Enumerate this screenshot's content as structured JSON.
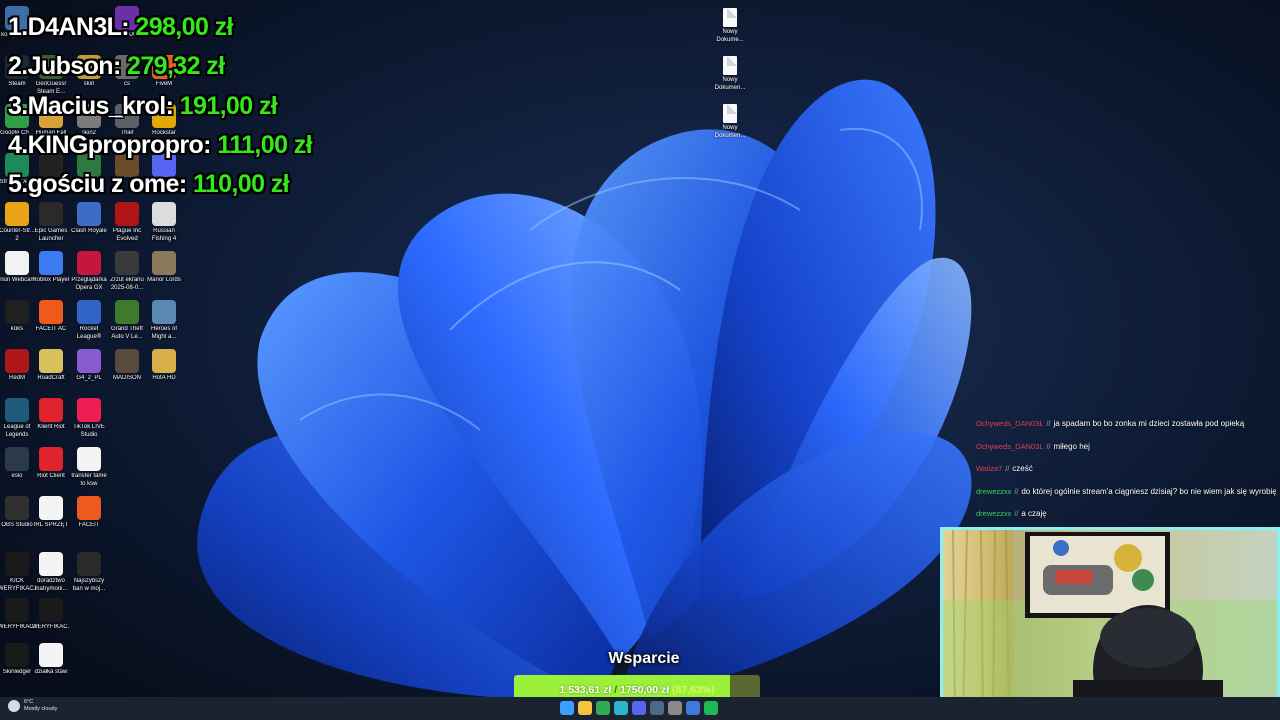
{
  "desktop": {
    "left_icons": [
      {
        "label": "komputer ...",
        "icon": "computer-icon",
        "color": "#3d6ea8"
      },
      {
        "label": "GALAXY",
        "icon": "galaxy-icon",
        "color": "#6b2fa8"
      },
      {
        "label": "Steam",
        "icon": "steam-icon",
        "color": "#1b2838"
      },
      {
        "label": "GeoGuessr Steam E...",
        "icon": "geoguessr-icon",
        "color": "#3a5f2f"
      },
      {
        "label": "skin",
        "icon": "folder-icon",
        "color": "#c79a37"
      },
      {
        "label": "cs",
        "icon": "folder-icon",
        "color": "#6a6a6a"
      },
      {
        "label": "FiveM",
        "icon": "fivem-icon",
        "color": "#e5601f"
      },
      {
        "label": "Google Ch...",
        "icon": "chrome-icon",
        "color": "#2f9e44"
      },
      {
        "label": "Human Fall Flat",
        "icon": "human-fall-flat-icon",
        "color": "#d8a23a"
      },
      {
        "label": "skin2",
        "icon": "folder-icon",
        "color": "#7a7a7a"
      },
      {
        "label": "Thief",
        "icon": "thief-icon",
        "color": "#5b5f66"
      },
      {
        "label": "Rockstar",
        "icon": "rockstar-icon",
        "color": "#e0a800"
      },
      {
        "label": "Strea... Deck",
        "icon": "stream-deck-icon",
        "color": "#1e8a5a"
      },
      {
        "label": "",
        "icon": "app-icon",
        "color": "#222"
      },
      {
        "label": "",
        "icon": "app-icon",
        "color": "#2c7a3f"
      },
      {
        "label": "",
        "icon": "app-icon",
        "color": "#6b4b2a"
      },
      {
        "label": "",
        "icon": "discord-icon",
        "color": "#5865f2"
      },
      {
        "label": "Counter-Str... 2",
        "icon": "cs2-icon",
        "color": "#e8a317"
      },
      {
        "label": "Epic Games Launcher",
        "icon": "epic-games-icon",
        "color": "#2a2a2a"
      },
      {
        "label": "Clash Royale",
        "icon": "clash-royale-icon",
        "color": "#3b6cc6"
      },
      {
        "label": "Plague Inc Evolved",
        "icon": "plague-inc-icon",
        "color": "#b01414"
      },
      {
        "label": "Russian Fishing 4",
        "icon": "russian-fishing-icon",
        "color": "#dcdcdc"
      },
      {
        "label": "Iriun Webcam",
        "icon": "iriun-webcam-icon",
        "color": "#f2f2f2"
      },
      {
        "label": "Roblox Player",
        "icon": "roblox-icon",
        "color": "#3d7bf2"
      },
      {
        "label": "Przeglądarka Opera GX",
        "icon": "opera-gx-icon",
        "color": "#c3173b"
      },
      {
        "label": "Zrzut ekranu 2025-08-0...",
        "icon": "screenshot-icon",
        "color": "#3a3a3a"
      },
      {
        "label": "Manor Lords",
        "icon": "manor-lords-icon",
        "color": "#8a7a5a"
      },
      {
        "label": "koks",
        "icon": "file-icon",
        "color": "#202020"
      },
      {
        "label": "FACEIT AC",
        "icon": "faceit-ac-icon",
        "color": "#ef5a1c"
      },
      {
        "label": "Rocket League®",
        "icon": "rocket-league-icon",
        "color": "#2f66c6"
      },
      {
        "label": "Grand Theft Auto V Le...",
        "icon": "gta-v-icon",
        "color": "#3e7a2d"
      },
      {
        "label": "Heroes of Might a...",
        "icon": "heroes-icon",
        "color": "#5a8ab3"
      },
      {
        "label": "RedM",
        "icon": "redm-icon",
        "color": "#b0151a"
      },
      {
        "label": "RoadCraft",
        "icon": "roadcraft-icon",
        "color": "#d8c05a"
      },
      {
        "label": "G4_2_PL",
        "icon": "folder-icon",
        "color": "#8a5ad0"
      },
      {
        "label": "MADISON",
        "icon": "madison-icon",
        "color": "#5a4a3a"
      },
      {
        "label": "HotA HD",
        "icon": "hota-icon",
        "color": "#d8b04a"
      },
      {
        "label": "League of Legends",
        "icon": "league-icon",
        "color": "#1e5a7a"
      },
      {
        "label": "Klient Riot",
        "icon": "riot-client-icon",
        "color": "#e0242f"
      },
      {
        "label": "TikTok LIVE Studio",
        "icon": "tiktok-icon",
        "color": "#ee1d52"
      },
      {
        "label": "eslo",
        "icon": "file-icon",
        "color": "#2a3a4a"
      },
      {
        "label": "Riot Client",
        "icon": "riot-client-icon",
        "color": "#e0242f"
      },
      {
        "label": "transfer fame to ksw",
        "icon": "document-icon",
        "color": "#f4f4f4"
      },
      {
        "label": "OBS Studio",
        "icon": "obs-icon",
        "color": "#303030"
      },
      {
        "label": "IRL SPRZĘT",
        "icon": "document-icon",
        "color": "#f4f4f4"
      },
      {
        "label": "FACEIT",
        "icon": "faceit-icon",
        "color": "#ef5a1c"
      },
      {
        "label": "KICK WERYFIKACJA",
        "icon": "file-icon",
        "color": "#1a1a1a"
      },
      {
        "label": "doradztwo matrymoni...",
        "icon": "document-icon",
        "color": "#f4f4f4"
      },
      {
        "label": "Najszybszy ban w moj...",
        "icon": "file-icon",
        "color": "#2a2a2a"
      },
      {
        "label": "WERYFIKACJA",
        "icon": "file-icon",
        "color": "#1a1a1a"
      },
      {
        "label": "WERYFIKAC...",
        "icon": "file-icon",
        "color": "#1a1a1a"
      },
      {
        "label": "Skinledger",
        "icon": "skinledger-icon",
        "color": "#1a1a1a"
      },
      {
        "label": "działka staw",
        "icon": "document-icon",
        "color": "#f4f4f4"
      }
    ],
    "right_icons": [
      {
        "label": "Nowy Dokume...",
        "icon": "document-icon"
      },
      {
        "label": "Nowy Dokumen...",
        "icon": "document-icon"
      },
      {
        "label": "Nowy Dokumen...",
        "icon": "document-icon"
      }
    ]
  },
  "leaderboard": [
    {
      "rank": "1.",
      "name": "D4AN3L:",
      "amount": "298,00 zł"
    },
    {
      "rank": "2.",
      "name": "Jubson:",
      "amount": "279,32 zł"
    },
    {
      "rank": "3.",
      "name": "Macius_krol:",
      "amount": "191,00 zł"
    },
    {
      "rank": "4.",
      "name": "KINGpropropro:",
      "amount": "111,00 zł"
    },
    {
      "rank": "5.",
      "name": "gościu z ome:",
      "amount": "110,00 zł"
    }
  ],
  "chat": [
    {
      "user": "Ochyweds_DAN03L",
      "user_color": "#e0404a",
      "text": "ja spadam bo bo zonka mi dzieci zostawła pod opieką"
    },
    {
      "user": "Ochyweds_DAN03L",
      "user_color": "#e0404a",
      "text": "miłego hej"
    },
    {
      "user": "Waliza7",
      "user_color": "#e0404a",
      "text": "cześć"
    },
    {
      "user": "drewezzxx",
      "user_color": "#36d35a",
      "text": "do której ogólnie stream'a ciągniesz dzisiaj? bo nie wiem jak się wyrobię"
    },
    {
      "user": "drewezzxx",
      "user_color": "#36d35a",
      "text": "a czaję"
    }
  ],
  "chat_separator": "//",
  "donation_goal": {
    "title": "Wsparcie",
    "current": "1 533,61 zł",
    "separator": "/",
    "target": "1750,00 zł",
    "percent_label": "(87,63%)",
    "progress": 0.8763,
    "fill_color": "#9bf03a"
  },
  "taskbar": {
    "weather_temp": "6°C",
    "weather_desc": "Mostly cloudy",
    "apps": [
      {
        "icon": "windows-start-icon",
        "color": "#3aa0ff"
      },
      {
        "icon": "file-explorer-icon",
        "color": "#f2c440"
      },
      {
        "icon": "chrome-icon",
        "color": "#34a853"
      },
      {
        "icon": "edge-icon",
        "color": "#2fb5c9"
      },
      {
        "icon": "discord-icon",
        "color": "#5865f2"
      },
      {
        "icon": "steam-icon",
        "color": "#4a6a8a"
      },
      {
        "icon": "obs-icon",
        "color": "#8a8a8a"
      },
      {
        "icon": "app-icon",
        "color": "#3f7ad8"
      },
      {
        "icon": "spotify-icon",
        "color": "#1db954"
      }
    ]
  },
  "colors": {
    "leader_name": "#ffffff",
    "leader_amount": "#35e81c",
    "webcam_border": "#8af0f2",
    "wallpaper_bloom": "#1f55e8"
  }
}
